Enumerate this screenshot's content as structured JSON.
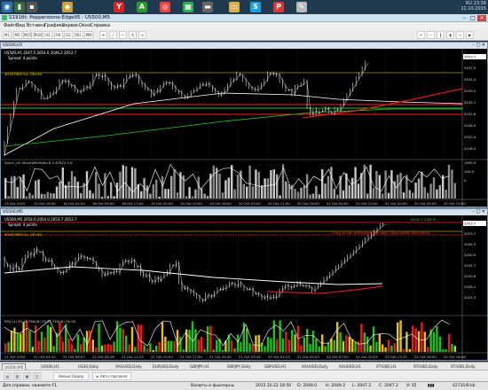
{
  "taskbar": {
    "icons": [
      {
        "name": "start-orb-icon",
        "glyph": "◉",
        "color": "#2b6fb0"
      },
      {
        "name": "mt4-icon",
        "glyph": "▮",
        "color": "#3a6a3a"
      },
      {
        "name": "app-icon-2",
        "glyph": "▪",
        "color": "#555"
      },
      {
        "name": "browser-icon",
        "glyph": "◆",
        "color": "#c9a13a"
      },
      {
        "name": "yandex-icon",
        "glyph": "Y",
        "color": "#d22"
      },
      {
        "name": "green-a-icon",
        "glyph": "A",
        "color": "#2a9a2a"
      },
      {
        "name": "chrome-icon",
        "glyph": "◎",
        "color": "#e44"
      },
      {
        "name": "grid-icon",
        "glyph": "▦",
        "color": "#3a5"
      },
      {
        "name": "terminal-icon",
        "glyph": "▬",
        "color": "#666"
      },
      {
        "name": "folder-icon",
        "glyph": "▭",
        "color": "#d9b04a"
      },
      {
        "name": "skype-icon",
        "glyph": "S",
        "color": "#1ba0e1"
      },
      {
        "name": "p-icon",
        "glyph": "P",
        "color": "#d33"
      },
      {
        "name": "notepad-icon",
        "glyph": "✎",
        "color": "#bbb"
      }
    ],
    "clock_time": "23:38",
    "clock_date": "22.10.2015",
    "lang": "RU"
  },
  "window": {
    "title": "S1916t: Pepperstone-Edge05 - US500,M5",
    "min": "–",
    "max": "□",
    "close": "✕"
  },
  "menu": [
    "Файл",
    "Вид",
    "Вставка",
    "Графики",
    "Сервис",
    "Окно",
    "Справка"
  ],
  "toolbar": {
    "timeframes": [
      "M1",
      "M5",
      "M15",
      "M30",
      "H1",
      "H4",
      "D1",
      "W1",
      "MN"
    ]
  },
  "chart_top": {
    "title": "US500,H1",
    "ohlc": "US500,H1  2047.5 2054.0 2046.2 2053.7",
    "spread": "Spread: 4 points",
    "level_label": "#2037983  Su: 150.00",
    "indicator_label": "Stoch_cm  StochWithRatio 8 3 ATR24 5.6",
    "prices": [
      "2051.7",
      "2047.5",
      "2043.4",
      "2039.2",
      "2035.1",
      "2031.6",
      "2026.5",
      "2022.4",
      "2018.3"
    ],
    "current_price": "2053.7",
    "ind_levels": [
      "1995.5",
      "100.0",
      "0"
    ],
    "x_labels": [
      "15 Oct 2015",
      "15 Oct 16:00",
      "16 Oct 01:00",
      "16 Oct 09:00",
      "16 Oct 17:00",
      "19 Oct 02:00",
      "19 Oct 10:00",
      "19 Oct 18:00",
      "20 Oct 03:00",
      "20 Oct 11:00",
      "20 Oct 19:00",
      "21 Oct 04:00",
      "21 Oct 12:00",
      "21 Oct 20:00",
      "22 Oct 05:00",
      "22 Oct 13:00"
    ]
  },
  "chart_bottom": {
    "title": "US500,M5",
    "ohlc": "US500,M5  2054.0 2054.0 2053.7 2053.7",
    "spread": "Spread: 4 points",
    "level_label": "#2037983  Su: 150.00",
    "trade_label": "D.Ch ↑ 1.63 %",
    "annot": "↑ buy in Ltd: authorized buy stop / Stop profits over ethics",
    "indicator_label": "RSI(14) 65.26 SMA(8) 55.21 EMA(8) 56.28",
    "prices": [
      "2055.4",
      "2053.7",
      "2045.3",
      "2040.5",
      "2035.7",
      "2030.9",
      "2026.1",
      "2021.3"
    ],
    "x_labels": [
      "21 Oct 2015",
      "21 Oct 04:10",
      "21 Oct 06:03",
      "21 Oct 09:28",
      "21 Oct 12:15",
      "21 Oct 15:03",
      "21 Oct 17:50",
      "21 Oct 20:40",
      "21 Oct 23:45",
      "22 Oct 02:23",
      "22 Oct 05:03",
      "22 Oct 07:50",
      "22 Oct 10:25",
      "22 Oct 13:15",
      "22 Oct 16:00",
      "22 Oct 18:48"
    ]
  },
  "tabs": [
    "US500,M5",
    "US500,H1",
    "US30,Daily",
    "XAGUSD,Daily",
    "EURUSD,Daily",
    "GBPJPY,H1",
    "GBPJPY,Daily",
    "GBPUSD,H1",
    "XAUUSD,Daily",
    "XAUUSD,H1",
    "XTIUSD,H1",
    "XTIUSD,Daily",
    "XTIUSD,Daily"
  ],
  "bottombar": {
    "new_order": "Новый Ордер",
    "auto_trading": "Авто-торговля"
  },
  "statusbar": {
    "help": "Для справки, нажмите F1",
    "profile": "Валюты и фьючерсы",
    "datetime": "2015.10.22 18:50",
    "open": "O: 2048.0",
    "high": "H: 2049.2",
    "low": "L: 2047.2",
    "close": "C: 2047.2",
    "vol": "V: 35",
    "traffic": "42731/8 kb"
  },
  "colors": {
    "support": "#ff2020",
    "ma_white": "#ffffff",
    "ma_green": "#22c822",
    "up_bar": "#e8e8e8",
    "hist_red": "#e02020",
    "hist_green": "#20c020",
    "hist_yellow": "#e0c020"
  }
}
